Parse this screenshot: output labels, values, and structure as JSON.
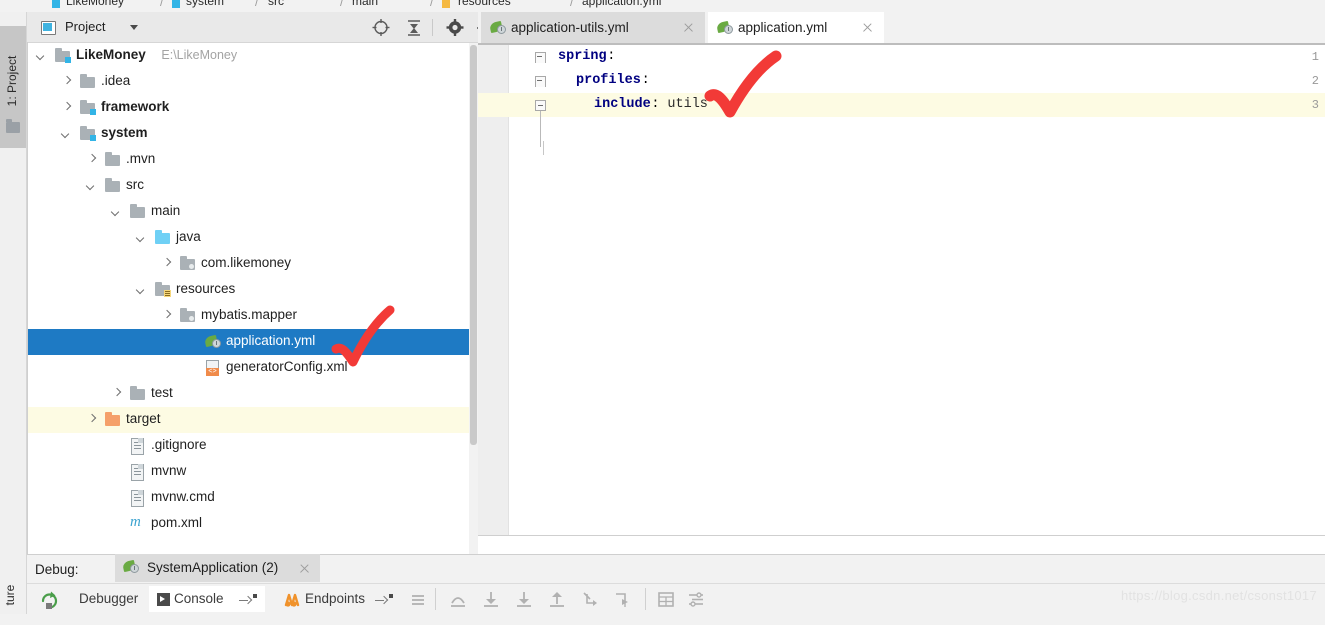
{
  "window": {
    "left_tool_tab": "1: Project",
    "left_tool_tab_bottom": "ture"
  },
  "breadcrumb": {
    "items": [
      "LikeMoney",
      "system",
      "src",
      "main",
      "resources",
      "application.yml"
    ],
    "separator": "/"
  },
  "project_panel": {
    "title": "Project",
    "header_icons": [
      {
        "name": "locate-icon",
        "label": "locate"
      },
      {
        "name": "collapse-all-icon",
        "label": "collapse-all"
      },
      {
        "name": "gear-icon",
        "label": "settings"
      },
      {
        "name": "minimize-icon",
        "label": "minimize"
      }
    ],
    "tree": [
      {
        "label": "LikeMoney",
        "sub": "E:\\LikeMoney",
        "depth": 0,
        "arrow": "down",
        "icon": "module-folder",
        "bold": true,
        "state": "normal"
      },
      {
        "label": ".idea",
        "sub": "",
        "depth": 1,
        "arrow": "right",
        "icon": "folder",
        "bold": false,
        "state": "normal"
      },
      {
        "label": "framework",
        "sub": "",
        "depth": 1,
        "arrow": "right",
        "icon": "module-folder",
        "bold": true,
        "state": "normal"
      },
      {
        "label": "system",
        "sub": "",
        "depth": 1,
        "arrow": "down",
        "icon": "module-folder",
        "bold": true,
        "state": "normal"
      },
      {
        "label": ".mvn",
        "sub": "",
        "depth": 2,
        "arrow": "right",
        "icon": "folder",
        "bold": false,
        "state": "normal"
      },
      {
        "label": "src",
        "sub": "",
        "depth": 2,
        "arrow": "down",
        "icon": "folder",
        "bold": false,
        "state": "normal"
      },
      {
        "label": "main",
        "sub": "",
        "depth": 3,
        "arrow": "down",
        "icon": "folder",
        "bold": false,
        "state": "normal"
      },
      {
        "label": "java",
        "sub": "",
        "depth": 4,
        "arrow": "down",
        "icon": "source-folder",
        "bold": false,
        "state": "normal"
      },
      {
        "label": "com.likemoney",
        "sub": "",
        "depth": 5,
        "arrow": "right",
        "icon": "package",
        "bold": false,
        "state": "normal"
      },
      {
        "label": "resources",
        "sub": "",
        "depth": 4,
        "arrow": "down",
        "icon": "resource-folder",
        "bold": false,
        "state": "normal"
      },
      {
        "label": "mybatis.mapper",
        "sub": "",
        "depth": 5,
        "arrow": "right",
        "icon": "package",
        "bold": false,
        "state": "normal"
      },
      {
        "label": "application.yml",
        "sub": "",
        "depth": 6,
        "arrow": "none",
        "icon": "spring-yaml",
        "bold": false,
        "state": "selected"
      },
      {
        "label": "generatorConfig.xml",
        "sub": "",
        "depth": 6,
        "arrow": "none",
        "icon": "xml",
        "bold": false,
        "state": "normal"
      },
      {
        "label": "test",
        "sub": "",
        "depth": 3,
        "arrow": "right",
        "icon": "folder",
        "bold": false,
        "state": "normal"
      },
      {
        "label": "target",
        "sub": "",
        "depth": 2,
        "arrow": "right",
        "icon": "excluded-folder",
        "bold": false,
        "state": "highlight"
      },
      {
        "label": ".gitignore",
        "sub": "",
        "depth": 3,
        "arrow": "none",
        "icon": "file",
        "bold": false,
        "state": "normal"
      },
      {
        "label": "mvnw",
        "sub": "",
        "depth": 3,
        "arrow": "none",
        "icon": "file",
        "bold": false,
        "state": "normal"
      },
      {
        "label": "mvnw.cmd",
        "sub": "",
        "depth": 3,
        "arrow": "none",
        "icon": "file",
        "bold": false,
        "state": "normal"
      },
      {
        "label": "pom.xml",
        "sub": "",
        "depth": 3,
        "arrow": "none",
        "icon": "maven",
        "bold": false,
        "state": "normal"
      }
    ]
  },
  "editor": {
    "tabs": [
      {
        "label": "application-utils.yml",
        "icon": "spring-yaml-icon",
        "active": false
      },
      {
        "label": "application.yml",
        "icon": "spring-yaml-icon",
        "active": true
      }
    ],
    "file": "application.yml",
    "lines": [
      {
        "num": "1",
        "indent": 0,
        "key": "spring",
        "colon": ":",
        "value": "",
        "fold": "open",
        "highlight": false
      },
      {
        "num": "2",
        "indent": 1,
        "key": "profiles",
        "colon": ":",
        "value": "",
        "fold": "open",
        "highlight": false
      },
      {
        "num": "3",
        "indent": 2,
        "key": "include",
        "colon": ":",
        "value": "utils",
        "fold": "closed",
        "highlight": true
      }
    ]
  },
  "debug_panel": {
    "label": "Debug:",
    "session_tab": "SystemApplication (2)",
    "toolbar_tabs": [
      {
        "label": "Debugger",
        "icon": "none",
        "selected": false,
        "pin": false
      },
      {
        "label": "Console",
        "icon": "console-icon",
        "selected": true,
        "pin": true
      },
      {
        "label": "Endpoints",
        "icon": "endpoints-icon",
        "selected": false,
        "pin": true
      }
    ],
    "step_icons": [
      "menu-icon",
      "step-over-icon",
      "step-into-icon",
      "force-step-into-icon",
      "step-out-icon",
      "drop-frame-icon",
      "run-to-cursor-icon",
      "evaluate-icon",
      "settings-layout-icon"
    ],
    "rerun_icon": "rerun-icon",
    "watermark": "https://blog.csdn.net/csonst1017"
  },
  "colors": {
    "selection_blue": "#1e7ac4",
    "highlight_yellow": "#fdfbe3",
    "annotation_red": "#f23a37",
    "spring_green": "#6aaa43",
    "accent_blue": "#32b4e6",
    "excluded_orange": "#f5a06a"
  }
}
